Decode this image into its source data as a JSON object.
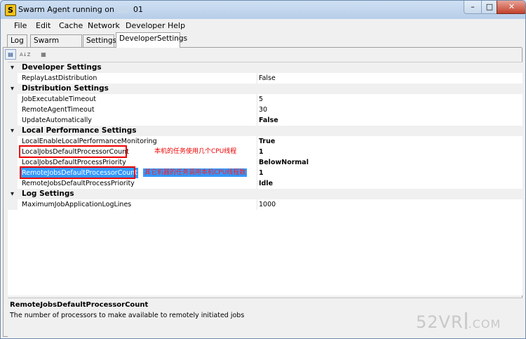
{
  "window": {
    "title_prefix": "Swarm Agent running on",
    "title_suffix": "01",
    "app_icon": "S",
    "min_glyph": "–",
    "max_glyph": "□",
    "close_glyph": "✕"
  },
  "menu": [
    "File",
    "Edit",
    "Cache",
    "Network",
    "Developer",
    "Help"
  ],
  "tabs": [
    {
      "label": "Log",
      "active": false
    },
    {
      "label": "Swarm Status",
      "active": false
    },
    {
      "label": "Settings",
      "active": false
    },
    {
      "label": "DeveloperSettings",
      "active": true
    }
  ],
  "toolbar": {
    "categorized_icon": "categorized-icon",
    "alphabetical_icon": "alphabetical-sort-icon",
    "alphabetical_text": "A↓Z",
    "property_pages_icon": "property-pages-icon"
  },
  "categories": [
    {
      "label": "Developer Settings",
      "rows": [
        {
          "name": "ReplayLastDistribution",
          "value": "False",
          "bold": false
        }
      ]
    },
    {
      "label": "Distribution Settings",
      "rows": [
        {
          "name": "JobExecutableTimeout",
          "value": "5",
          "bold": false
        },
        {
          "name": "RemoteAgentTimeout",
          "value": "30",
          "bold": false
        },
        {
          "name": "UpdateAutomatically",
          "value": "False",
          "bold": true
        }
      ]
    },
    {
      "label": "Local Performance Settings",
      "rows": [
        {
          "name": "LocalEnableLocalPerformanceMonitoring",
          "value": "True",
          "bold": true
        },
        {
          "name": "LocalJobsDefaultProcessorCount",
          "value": "1",
          "bold": true
        },
        {
          "name": "LocalJobsDefaultProcessPriority",
          "value": "BelowNormal",
          "bold": true
        },
        {
          "name": "RemoteJobsDefaultProcessorCount",
          "value": "1",
          "bold": true,
          "selected": true
        },
        {
          "name": "RemoteJobsDefaultProcessPriority",
          "value": "Idle",
          "bold": true
        }
      ]
    },
    {
      "label": "Log Settings",
      "rows": [
        {
          "name": "MaximumJobApplicationLogLines",
          "value": "1000",
          "bold": false
        }
      ]
    }
  ],
  "annotations": {
    "local": "本机的任务使用几个CPU线程",
    "remote": "其它机器的任务调用本机CPU线程数"
  },
  "help": {
    "title": "RemoteJobsDefaultProcessorCount",
    "description": "The number of processors to make available to remotely initiated jobs"
  },
  "watermark": {
    "main": "52VR",
    "domain": ".COM"
  },
  "colors": {
    "selection": "#3399ff",
    "annotation": "#ee0000"
  }
}
